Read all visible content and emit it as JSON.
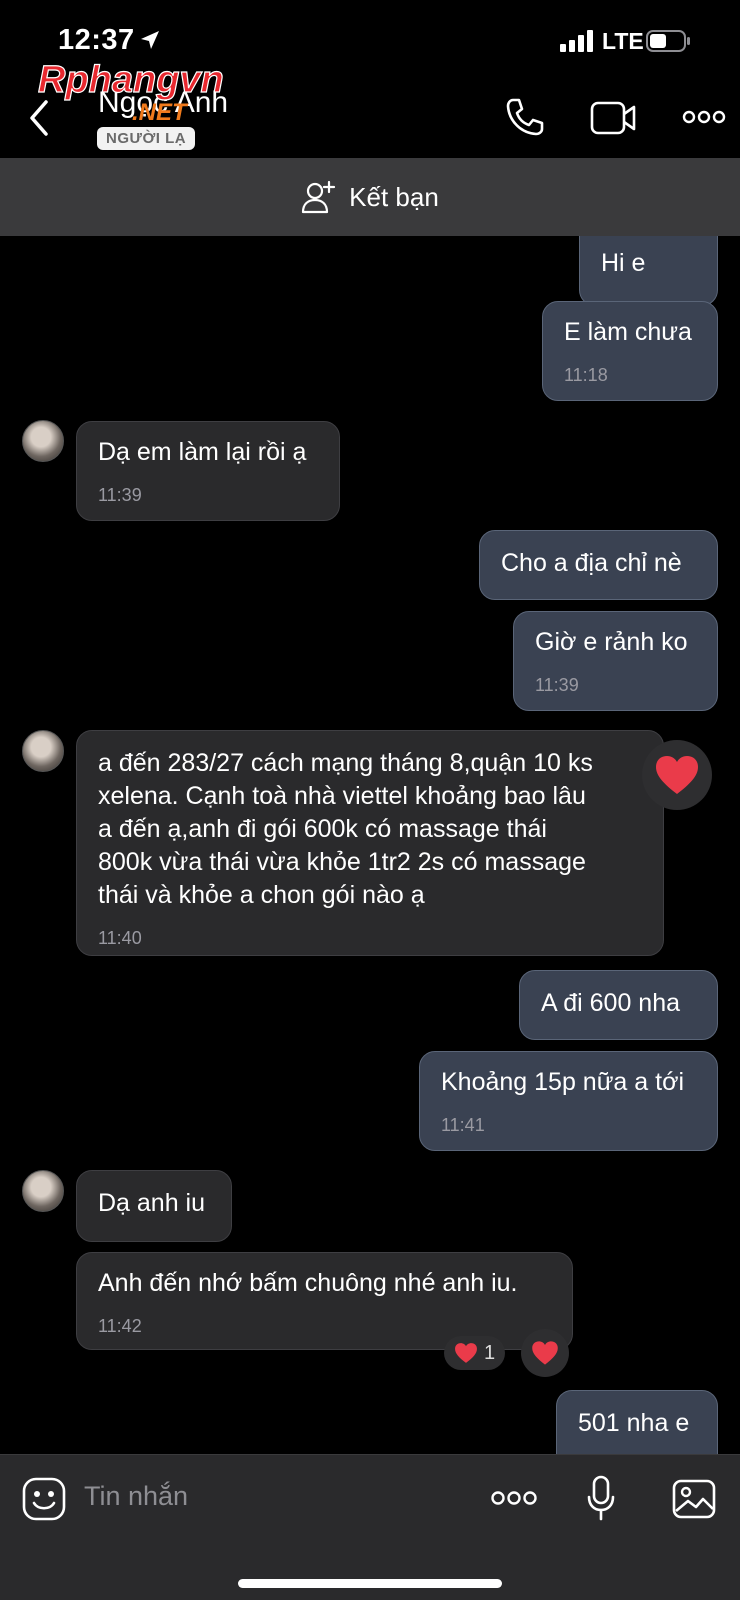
{
  "status_bar": {
    "time": "12:37",
    "network": "LTE"
  },
  "watermark": {
    "main": "Rphangvn",
    "sub": ".NET"
  },
  "header": {
    "name": "Ngọc Anh",
    "badge": "NGƯỜI LẠ"
  },
  "friend_bar": {
    "label": "Kết bạn"
  },
  "messages": [
    {
      "text": "Hi e"
    },
    {
      "text": "E làm chưa",
      "time": "11:18"
    },
    {
      "text": "Dạ em làm lại rồi ạ",
      "time": "11:39"
    },
    {
      "text": "Cho a địa chỉ nè"
    },
    {
      "text": "Giờ e rảnh ko",
      "time": "11:39"
    },
    {
      "text": "a đến 283/27 cách mạng tháng 8,quận 10 ks\nxelena. Cạnh toà nhà viettel khoảng bao lâu\na đến ạ,anh đi gói 600k có massage thái\n800k vừa thái vừa khỏe 1tr2 2s có massage\nthái và khỏe a chon gói nào ạ",
      "time": "11:40"
    },
    {
      "text": "A đi 600 nha"
    },
    {
      "text": "Khoảng 15p nữa a tới",
      "time": "11:41"
    },
    {
      "text": "Dạ anh iu"
    },
    {
      "text": "Anh đến nhớ bấm chuông nhé anh iu.",
      "time": "11:42"
    },
    {
      "text": "501 nha e"
    }
  ],
  "reactions": {
    "heart_count": "1"
  },
  "input": {
    "placeholder": "Tin nhắn"
  }
}
